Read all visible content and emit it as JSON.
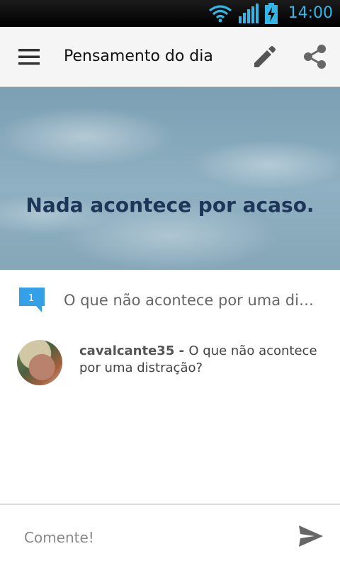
{
  "status_bar": {
    "time": "14:00",
    "icons": [
      "wifi-icon",
      "signal-icon",
      "battery-charging-icon"
    ],
    "accent_color": "#33b5e5"
  },
  "toolbar": {
    "title": "Pensamento do dia",
    "icons": [
      "menu-icon",
      "edit-icon",
      "share-icon"
    ]
  },
  "hero": {
    "quote": "Nada acontece por acaso."
  },
  "topic": {
    "badge_count": "1",
    "text": "O que não acontece por uma di…",
    "badge_color": "#33a0e8"
  },
  "comment": {
    "author": "cavalcante35",
    "separator": " - ",
    "text": "O que não acontece por uma distração?"
  },
  "input": {
    "placeholder": "Comente!",
    "send_icon": "send-icon"
  }
}
